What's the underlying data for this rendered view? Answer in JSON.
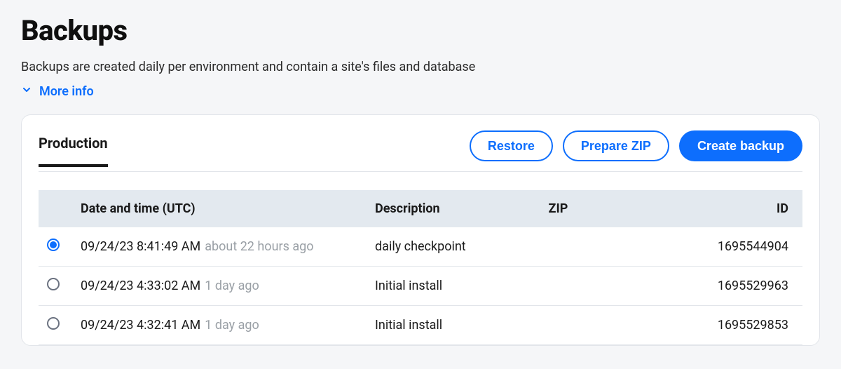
{
  "header": {
    "title": "Backups",
    "subtitle": "Backups are created daily per environment and contain a site's files and database",
    "more_info_label": "More info"
  },
  "tabs": {
    "active": "Production"
  },
  "actions": {
    "restore": "Restore",
    "prepare_zip": "Prepare ZIP",
    "create_backup": "Create backup"
  },
  "table": {
    "columns": {
      "date": "Date and time (UTC)",
      "description": "Description",
      "zip": "ZIP",
      "id": "ID"
    },
    "rows": [
      {
        "selected": true,
        "datetime": "09/24/23 8:41:49 AM",
        "relative": "about 22 hours ago",
        "description": "daily checkpoint",
        "zip": "",
        "id": "1695544904"
      },
      {
        "selected": false,
        "datetime": "09/24/23 4:33:02 AM",
        "relative": "1 day ago",
        "description": "Initial install",
        "zip": "",
        "id": "1695529963"
      },
      {
        "selected": false,
        "datetime": "09/24/23 4:32:41 AM",
        "relative": "1 day ago",
        "description": "Initial install",
        "zip": "",
        "id": "1695529853"
      }
    ]
  }
}
